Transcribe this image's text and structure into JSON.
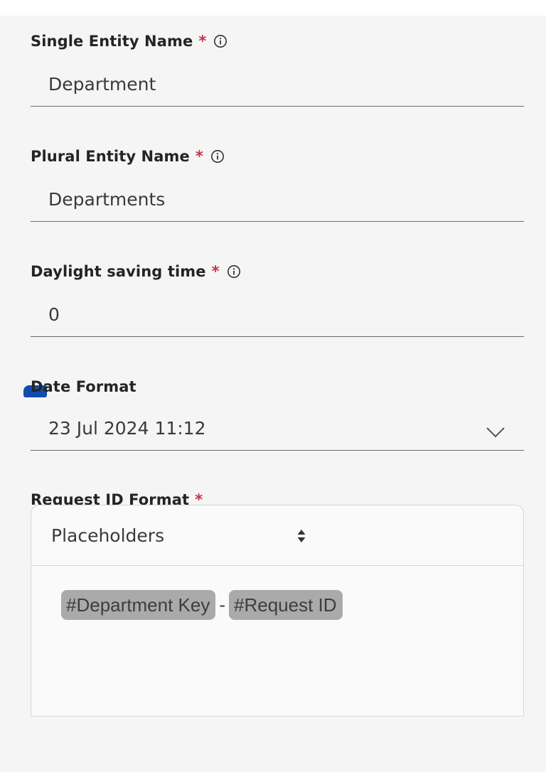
{
  "fields": {
    "single_entity": {
      "label": "Single Entity Name",
      "required_mark": "*",
      "value": "Department"
    },
    "plural_entity": {
      "label": "Plural Entity Name",
      "required_mark": "*",
      "value": "Departments"
    },
    "daylight_saving": {
      "label": "Daylight saving time",
      "required_mark": "*",
      "value": "0"
    },
    "date_format": {
      "label": "Date Format",
      "value": "23 Jul 2024 11:12"
    },
    "request_id_format": {
      "label": "Request ID Format",
      "required_mark": "*",
      "placeholder_select": "Placeholders",
      "tokens": [
        "#Department Key",
        "#Request ID"
      ],
      "separator": "-"
    }
  },
  "colors": {
    "required": "#c4314b",
    "focus_indicator": "#0f4cae",
    "token_bg": "#aaaaaa"
  },
  "icons": {
    "info": "info-circle-icon",
    "dropdown": "chevron-down-icon",
    "sort": "up-down-caret-icon"
  }
}
